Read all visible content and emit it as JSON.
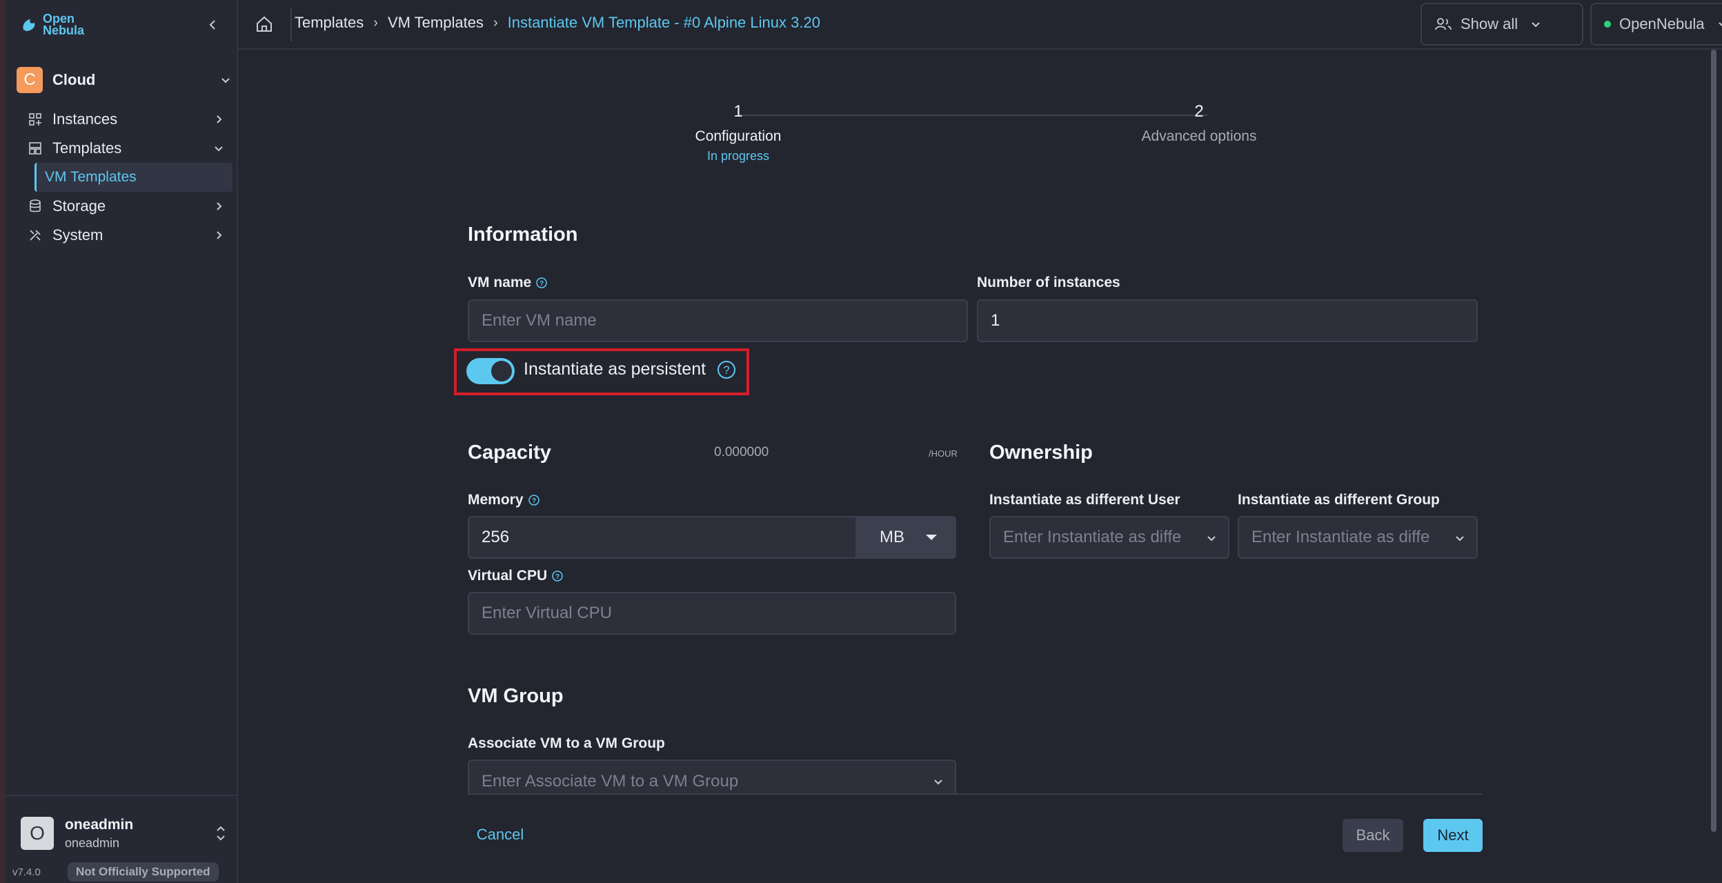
{
  "app": {
    "logo_text_line1": "Open",
    "logo_text_line2": "Nebula"
  },
  "sidebar": {
    "group": {
      "initial": "C",
      "name": "Cloud"
    },
    "items": [
      {
        "label": "Instances",
        "icon": "grid-icon"
      },
      {
        "label": "Templates",
        "icon": "template-icon"
      },
      {
        "label": "VM Templates"
      },
      {
        "label": "Storage",
        "icon": "database-icon"
      },
      {
        "label": "System",
        "icon": "tools-icon"
      }
    ],
    "user": {
      "initial": "O",
      "name": "oneadmin",
      "group": "oneadmin"
    },
    "version": "v7.4.0",
    "support_badge": "Not Officially Supported"
  },
  "topbar": {
    "breadcrumb": [
      "Templates",
      "VM Templates",
      "Instantiate VM Template - #0 Alpine Linux 3.20"
    ],
    "show_all": "Show all",
    "zone": "OpenNebula"
  },
  "stepper": {
    "steps": [
      {
        "num": "1",
        "title": "Configuration",
        "status": "In progress"
      },
      {
        "num": "2",
        "title": "Advanced options"
      }
    ]
  },
  "form": {
    "information_title": "Information",
    "vm_name_label": "VM name",
    "vm_name_placeholder": "Enter VM name",
    "instances_label": "Number of instances",
    "instances_value": "1",
    "persistent_label": "Instantiate as persistent",
    "persistent_on": true,
    "capacity_title": "Capacity",
    "price": "0.000000",
    "per_hour": "/HOUR",
    "memory_label": "Memory",
    "memory_value": "256",
    "memory_unit": "MB",
    "vcpu_label": "Virtual CPU",
    "vcpu_placeholder": "Enter Virtual CPU",
    "ownership_title": "Ownership",
    "user_label": "Instantiate as different User",
    "user_placeholder": "Enter Instantiate as diffe",
    "group_label": "Instantiate as different Group",
    "group_placeholder": "Enter Instantiate as diffe",
    "vmgroup_title": "VM Group",
    "vmgroup_label": "Associate VM to a VM Group",
    "vmgroup_placeholder": "Enter Associate VM to a VM Group"
  },
  "footer": {
    "cancel": "Cancel",
    "back": "Back",
    "next": "Next"
  },
  "colors": {
    "accent": "#5cc8ef",
    "highlight_box": "#d51e2a",
    "group_avatar": "#f49a5b"
  }
}
